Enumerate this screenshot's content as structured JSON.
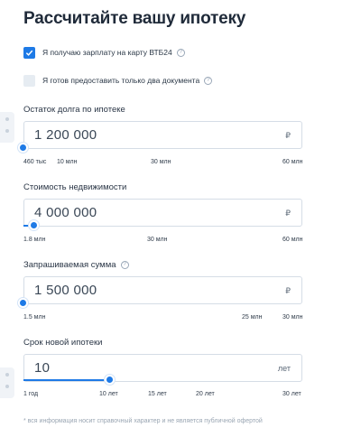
{
  "title": "Рассчитайте вашу ипотеку",
  "checkboxes": [
    {
      "label": "Я получаю зарплату на карту ВТБ24",
      "checked": true,
      "help": "?"
    },
    {
      "label": "Я готов предоставить только два документа",
      "checked": false,
      "help": "?"
    }
  ],
  "sliders": [
    {
      "label": "Остаток долга по ипотеке",
      "value": "1 200 000",
      "unit": "₽",
      "level": 0.0,
      "ticks": [
        "460 тыс",
        "10 млн",
        "30 млн",
        "60 млн"
      ]
    },
    {
      "label": "Стоимость недвижимости",
      "value": "4 000 000",
      "unit": "₽",
      "level": 0.04,
      "ticks": [
        "1.8 млн",
        "30 млн",
        "60 млн"
      ]
    },
    {
      "label": "Запрашиваемая сумма",
      "help": "?",
      "value": "1 500 000",
      "unit": "₽",
      "level": 0.0,
      "ticks": [
        "1.5 млн",
        "25 млн",
        "30 млн"
      ]
    },
    {
      "label": "Срок новой ипотеки",
      "value": "10",
      "unit": "лет",
      "level": 0.31,
      "ticks": [
        "1 год",
        "10 лет",
        "15 лет",
        "20 лет",
        "30 лет"
      ]
    }
  ],
  "footnote": "* вся информация носит справочный характер и не является публичной офертой",
  "colors": {
    "accent": "#1e7ae6",
    "text": "#202b3a",
    "border": "#d5dde6"
  },
  "icons": {
    "checkbox_checked": "checkmark-icon",
    "help": "question-circle-icon"
  }
}
